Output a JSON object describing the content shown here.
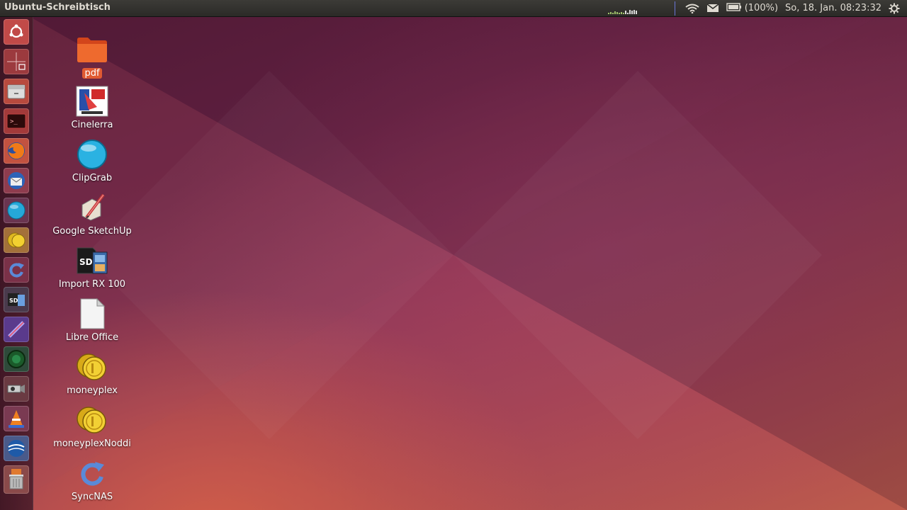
{
  "panel": {
    "title": "Ubuntu-Schreibtisch",
    "battery_text": "(100%)",
    "clock": "So, 18. Jan. 08:23:32"
  },
  "indicators": {
    "icons": [
      "system-monitor-icon",
      "wifi-icon",
      "mail-icon",
      "battery-icon",
      "gear-icon"
    ]
  },
  "launcher": {
    "items": [
      {
        "name": "dash-home-icon"
      },
      {
        "name": "workspace-switcher-icon"
      },
      {
        "name": "files-icon"
      },
      {
        "name": "terminal-icon"
      },
      {
        "name": "firefox-icon"
      },
      {
        "name": "thunderbird-icon"
      },
      {
        "name": "clipgrab-icon"
      },
      {
        "name": "moneyplex-icon"
      },
      {
        "name": "syncnas-icon"
      },
      {
        "name": "import-rx100-icon"
      },
      {
        "name": "sketchup-icon"
      },
      {
        "name": "globe-app-icon"
      },
      {
        "name": "camera-app-icon"
      },
      {
        "name": "vlc-icon"
      },
      {
        "name": "google-earth-icon"
      },
      {
        "name": "trash-icon"
      }
    ]
  },
  "desktop": {
    "icons": [
      {
        "label": "pdf",
        "icon": "folder-icon",
        "selected": true
      },
      {
        "label": "Cinelerra",
        "icon": "cinelerra-icon"
      },
      {
        "label": "ClipGrab",
        "icon": "clipgrab-icon"
      },
      {
        "label": "Google SketchUp",
        "icon": "sketchup-icon"
      },
      {
        "label": "Import RX 100",
        "icon": "sd-card-icon"
      },
      {
        "label": "Libre Office",
        "icon": "document-icon"
      },
      {
        "label": "moneyplex",
        "icon": "coins-icon"
      },
      {
        "label": "moneyplexNoddi",
        "icon": "coins-icon"
      },
      {
        "label": "SyncNAS",
        "icon": "sync-icon"
      }
    ]
  },
  "colors": {
    "selection": "#e05a32",
    "panel_bg": "#3c3b37",
    "wallpaper_dark": "#5a1d3a",
    "wallpaper_warm": "#b85a4c"
  }
}
